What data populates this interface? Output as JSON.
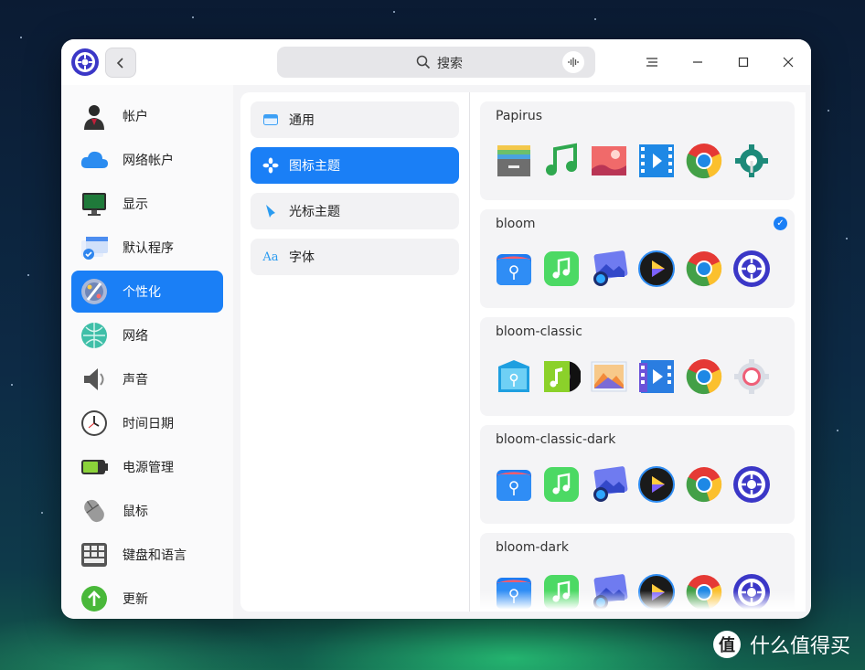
{
  "search": {
    "placeholder": "搜索"
  },
  "nav": {
    "items": [
      {
        "label": "帐户",
        "icon": "account-icon"
      },
      {
        "label": "网络帐户",
        "icon": "cloud-icon"
      },
      {
        "label": "显示",
        "icon": "monitor-icon"
      },
      {
        "label": "默认程序",
        "icon": "default-apps-icon"
      },
      {
        "label": "个性化",
        "icon": "personalization-icon",
        "active": true
      },
      {
        "label": "网络",
        "icon": "network-icon"
      },
      {
        "label": "声音",
        "icon": "speaker-icon"
      },
      {
        "label": "时间日期",
        "icon": "clock-icon"
      },
      {
        "label": "电源管理",
        "icon": "battery-icon"
      },
      {
        "label": "鼠标",
        "icon": "mouse-icon"
      },
      {
        "label": "键盘和语言",
        "icon": "keyboard-icon"
      },
      {
        "label": "更新",
        "icon": "update-icon"
      }
    ]
  },
  "personalization": {
    "items": [
      {
        "label": "通用",
        "icon": "general-icon"
      },
      {
        "label": "图标主题",
        "icon": "icon-theme-icon",
        "active": true
      },
      {
        "label": "光标主题",
        "icon": "cursor-icon"
      },
      {
        "label": "字体",
        "icon": "font-icon",
        "glyph": "Aa"
      }
    ]
  },
  "themes": [
    {
      "name": "Papirus",
      "selected": false
    },
    {
      "name": "bloom",
      "selected": true
    },
    {
      "name": "bloom-classic",
      "selected": false
    },
    {
      "name": "bloom-classic-dark",
      "selected": false
    },
    {
      "name": "bloom-dark",
      "selected": false
    }
  ],
  "watermark": {
    "text": "什么值得买",
    "logo": "值"
  },
  "colors": {
    "accent": "#1a7ff6",
    "window_bg": "#f4f4f6"
  }
}
